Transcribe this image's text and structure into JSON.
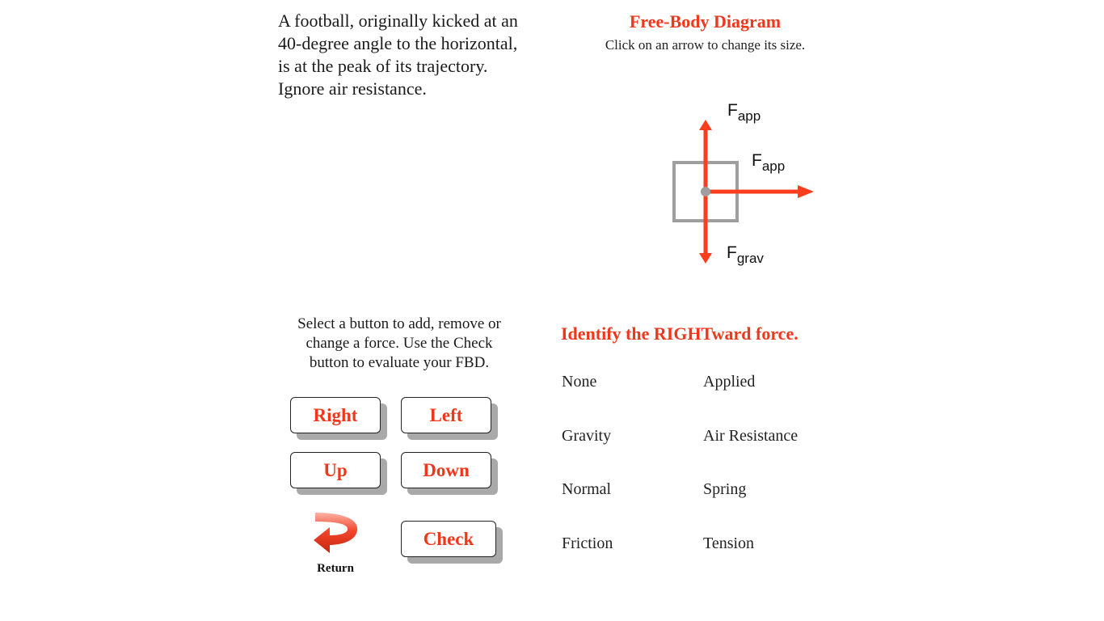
{
  "problem": {
    "line1": "A football, originally kicked at an",
    "line2": "40-degree angle to the horizontal,",
    "line3": "is at the peak of its trajectory.",
    "line4": "Ignore air resistance."
  },
  "fbd": {
    "title": "Free-Body Diagram",
    "subtitle": "Click on an arrow to change its size.",
    "arrow_color": "#fe3d1c",
    "box_color": "#9e9e9e",
    "forces": {
      "up": {
        "symbol": "F",
        "sub": "app"
      },
      "right": {
        "symbol": "F",
        "sub": "app"
      },
      "down": {
        "symbol": "F",
        "sub": "grav"
      }
    }
  },
  "instructions": {
    "line1": "Select a button to add, remove or",
    "line2": "change a force. Use the Check",
    "line3": "button to evaluate your FBD."
  },
  "buttons": {
    "right": "Right",
    "left": "Left",
    "up": "Up",
    "down": "Down",
    "check": "Check",
    "return": "Return"
  },
  "identify": {
    "prompt": "Identify the RIGHTward force.",
    "options": [
      "None",
      "Applied",
      "Gravity",
      "Air Resistance",
      "Normal",
      "Spring",
      "Friction",
      "Tension"
    ]
  },
  "accent_color": "#f0361b"
}
